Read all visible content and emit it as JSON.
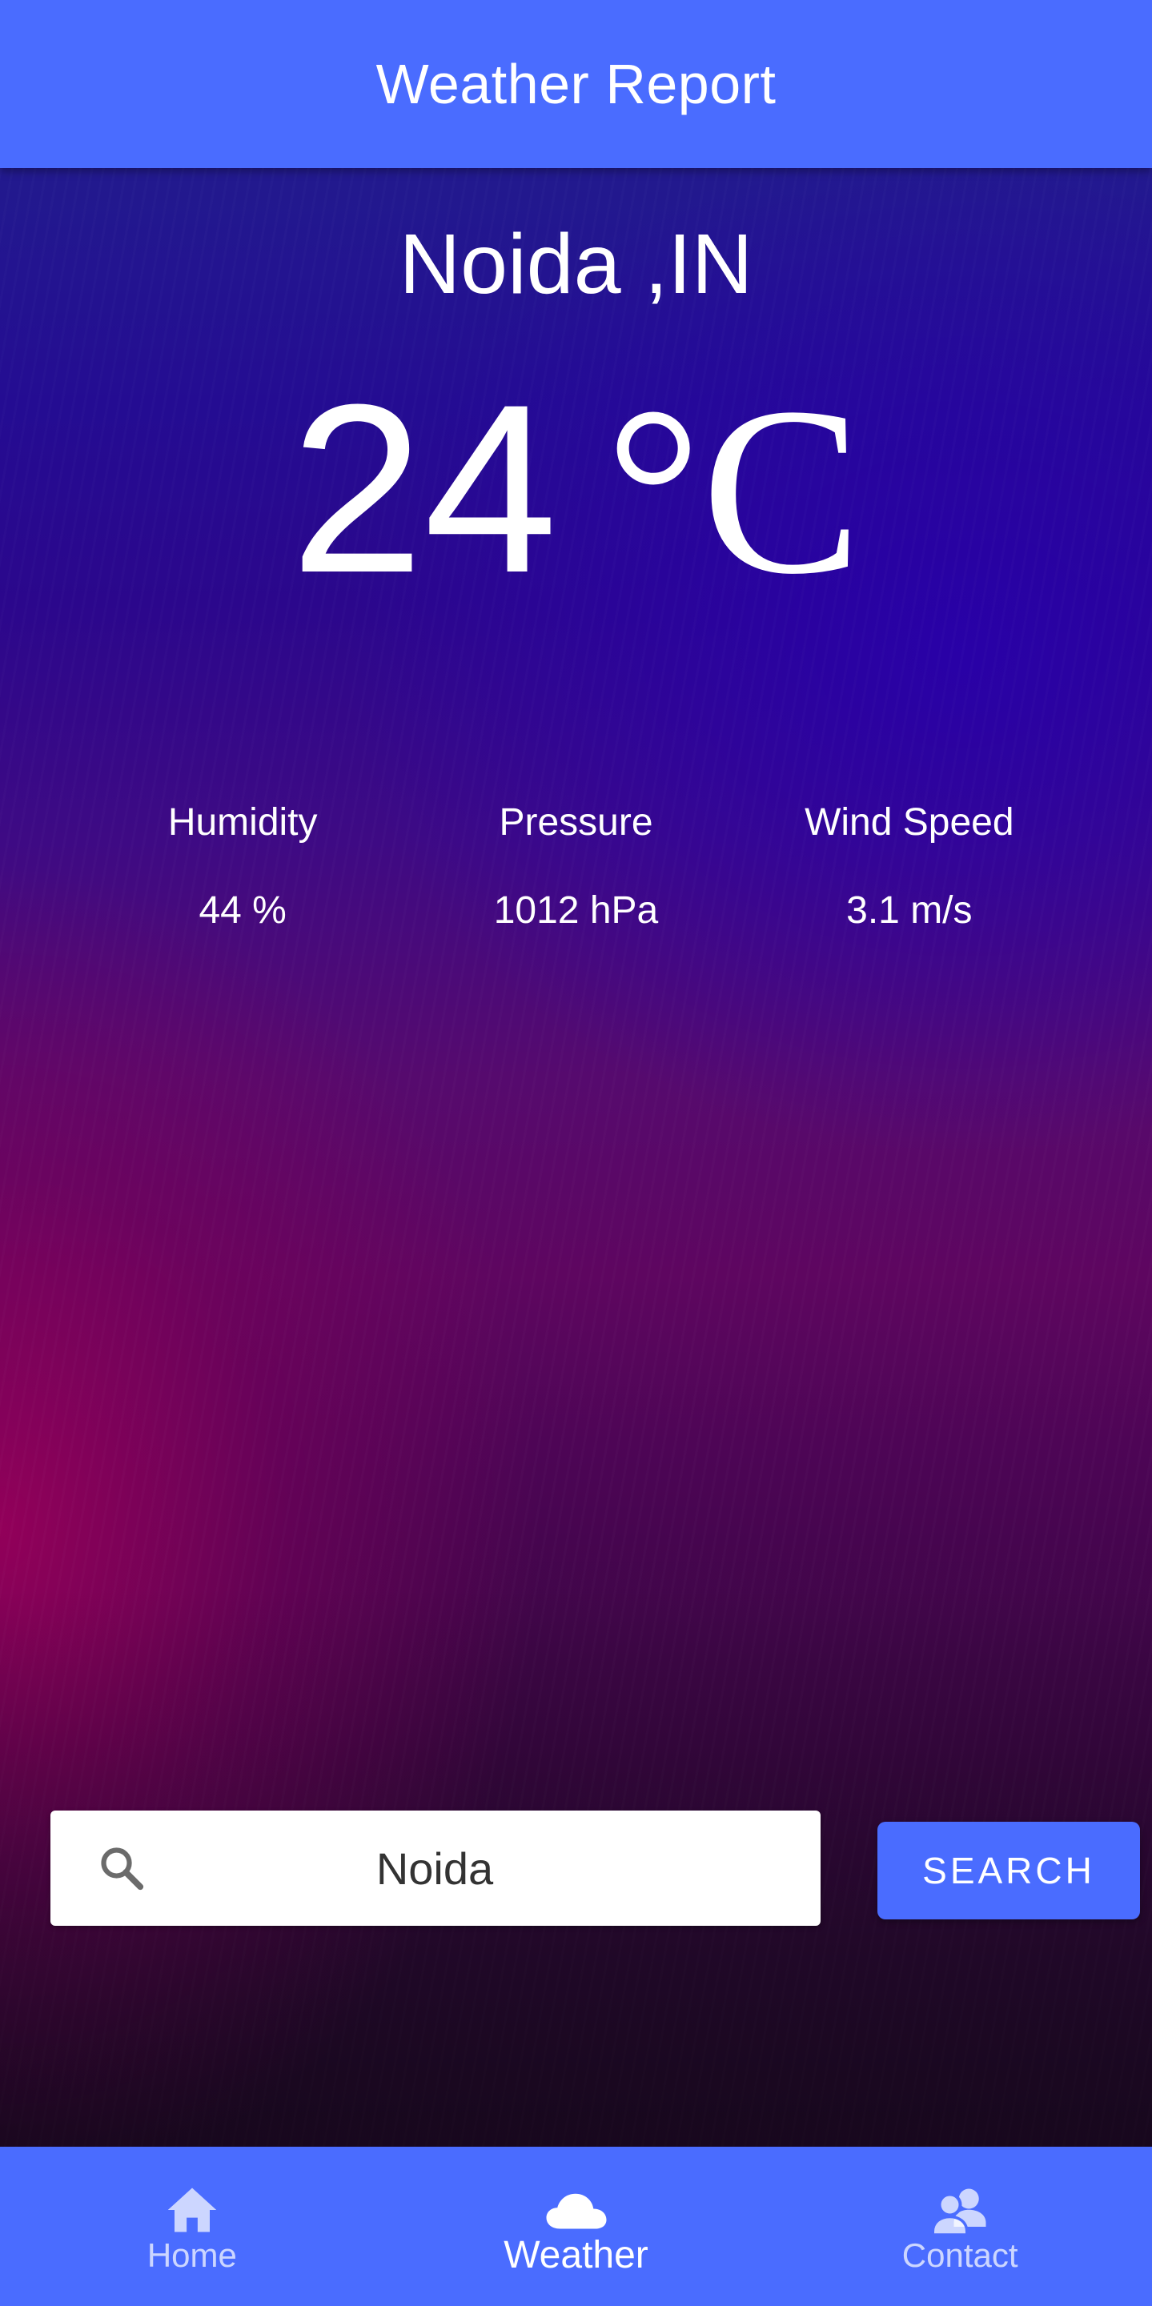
{
  "header": {
    "title": "Weather Report"
  },
  "weather": {
    "city": "Noida ,IN",
    "temperature": "24",
    "unit": "°C"
  },
  "stats": [
    {
      "label": "Humidity",
      "value": "44 %"
    },
    {
      "label": "Pressure",
      "value": "1012 hPa"
    },
    {
      "label": "Wind Speed",
      "value": "3.1 m/s"
    }
  ],
  "search": {
    "value": "Noida",
    "button_label": "SEARCH"
  },
  "nav": {
    "items": [
      {
        "label": "Home",
        "icon": "home-icon",
        "active": false
      },
      {
        "label": "Weather",
        "icon": "cloud-icon",
        "active": true
      },
      {
        "label": "Contact",
        "icon": "contact-icon",
        "active": false
      }
    ]
  },
  "colors": {
    "primary": "#4a6cff",
    "text": "#ffffff"
  }
}
